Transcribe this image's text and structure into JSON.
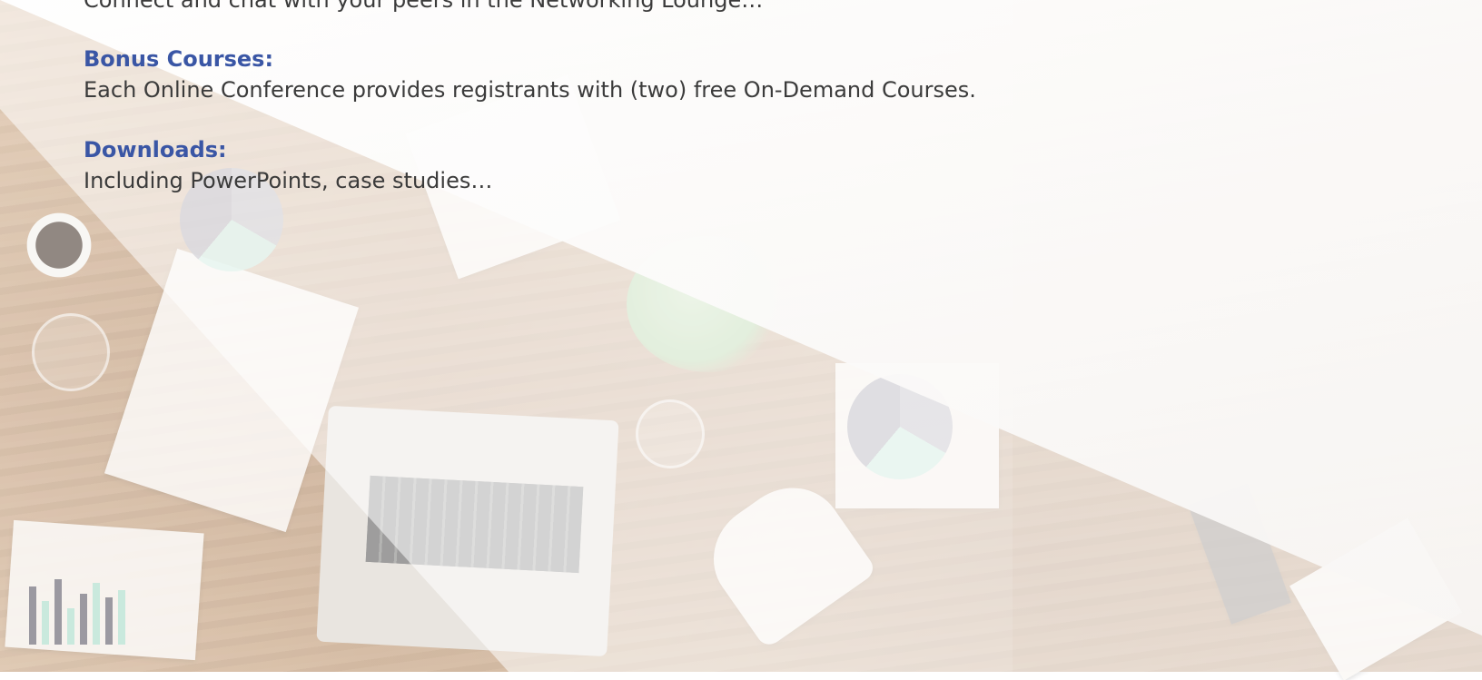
{
  "intro_line": "Connect and chat with your peers in the Networking Lounge…",
  "sections": [
    {
      "heading": "Bonus Courses:",
      "body": "Each Online Conference provides registrants with (two) free On-Demand Courses."
    },
    {
      "heading": "Downloads:",
      "body": "Including PowerPoints, case studies…"
    }
  ],
  "colors": {
    "heading": "#3a56a5",
    "body_text": "#3b3b3b"
  }
}
